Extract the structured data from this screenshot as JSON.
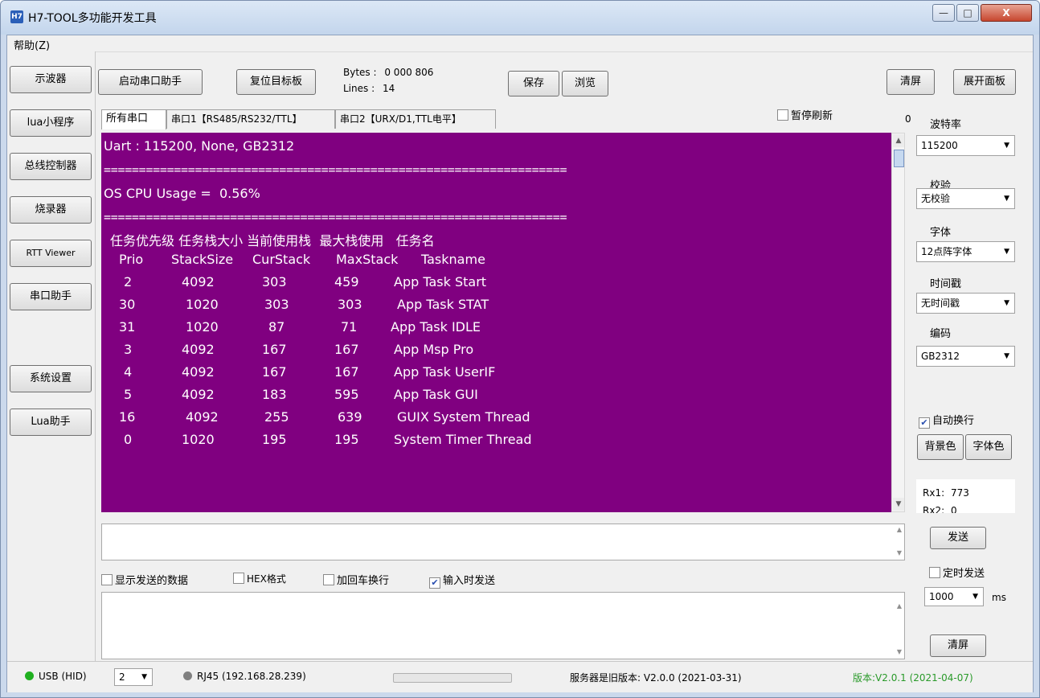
{
  "window": {
    "title": "H7-TOOL多功能开发工具",
    "icon_label": "H7",
    "minimize": "—",
    "maximize": "□",
    "close": "X"
  },
  "menu": {
    "help": "帮助(Z)"
  },
  "sidebar": {
    "items": [
      {
        "label": "示波器"
      },
      {
        "label": "lua小程序"
      },
      {
        "label": "总线控制器"
      },
      {
        "label": "烧录器"
      },
      {
        "label": "RTT Viewer"
      },
      {
        "label": "串口助手"
      },
      {
        "label": "系统设置"
      },
      {
        "label": "Lua助手"
      }
    ]
  },
  "toolbar": {
    "start_label": "启动串口助手",
    "reset_label": "复位目标板",
    "bytes_label": "Bytes :",
    "bytes_value": "0 000 806",
    "lines_label": "Lines :",
    "lines_value": "14",
    "save_label": "保存",
    "browse_label": "浏览",
    "clear_label": "清屏",
    "expand_label": "展开面板"
  },
  "tabs": [
    {
      "label": "所有串口"
    },
    {
      "label": "串口1【RS485/RS232/TTL】"
    },
    {
      "label": "串口2【URX/D1,TTL电平】"
    }
  ],
  "pause": {
    "label": "暂停刷新",
    "checked": false,
    "count": "0"
  },
  "terminal": {
    "header": "Uart : 115200, None, GB2312",
    "separator": "==================================================================",
    "cpu": "OS CPU Usage =  0.56%",
    "cn_header": "任务优先级 任务栈大小 当前使用栈  最大栈使用   任务名",
    "columns": [
      "Prio",
      "StackSize",
      "CurStack",
      "MaxStack",
      "Taskname"
    ],
    "rows": [
      [
        "2",
        "4092",
        "303",
        "459",
        "App Task Start"
      ],
      [
        "30",
        "1020",
        "303",
        "303",
        "App Task STAT"
      ],
      [
        "31",
        "1020",
        "87",
        "71",
        "App Task IDLE"
      ],
      [
        "3",
        "4092",
        "167",
        "167",
        "App Msp Pro"
      ],
      [
        "4",
        "4092",
        "167",
        "167",
        "App Task UserIF"
      ],
      [
        "5",
        "4092",
        "183",
        "595",
        "App Task GUI"
      ],
      [
        "16",
        "4092",
        "255",
        "639",
        "GUIX System Thread"
      ],
      [
        "0",
        "1020",
        "195",
        "195",
        "System Timer Thread"
      ]
    ],
    "bg_color": "#800080",
    "fg_color": "#ffffff"
  },
  "settings": {
    "baud_label": "波特率",
    "baud_value": "115200",
    "parity_label": "校验",
    "parity_value": "无校验",
    "font_label": "字体",
    "font_value": "12点阵字体",
    "timestamp_label": "时间戳",
    "timestamp_value": "无时间戳",
    "encoding_label": "编码",
    "encoding_value": "GB2312",
    "autowrap_label": "自动换行",
    "autowrap_checked": true,
    "bgcolor_label": "背景色",
    "fontcolor_label": "字体色",
    "rx1_label": "Rx1:",
    "rx1_value": "773",
    "rx2_label": "Rx2:",
    "rx2_value": "0"
  },
  "send": {
    "send_label": "发送",
    "timed_label": "定时发送",
    "timed_checked": false,
    "interval_value": "1000",
    "interval_unit": "ms",
    "clear_label": "清屏",
    "show_sent_label": "显示发送的数据",
    "show_sent_checked": false,
    "hex_label": "HEX格式",
    "hex_checked": false,
    "crlf_label": "加回车换行",
    "crlf_checked": false,
    "send_on_input_label": "输入时发送",
    "send_on_input_checked": true,
    "input_value": ""
  },
  "status": {
    "usb": "USB (HID)",
    "usb_color": "#20b020",
    "port_value": "2",
    "rj45": "RJ45 (192.168.28.239)",
    "rj45_color": "#808080",
    "server": "服务器是旧版本: V2.0.0 (2021-03-31)",
    "version": "版本:V2.0.1 (2021-04-07)",
    "version_color": "#2a9a2a"
  }
}
